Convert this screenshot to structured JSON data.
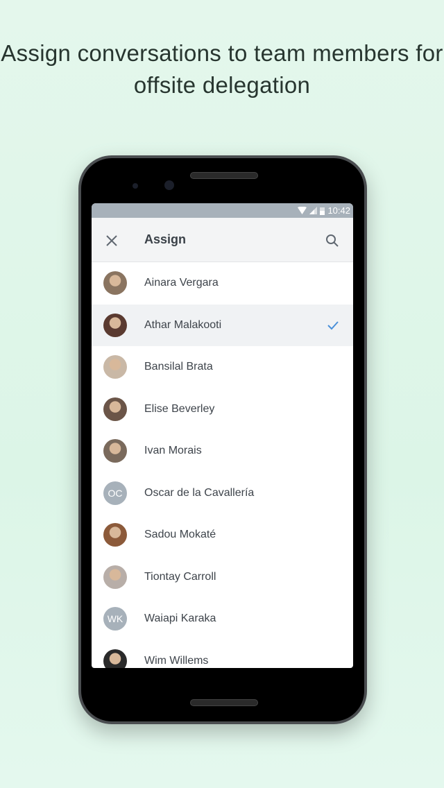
{
  "headline": "Assign conversations to team members for offsite delegation",
  "status_bar": {
    "time": "10:42",
    "icons": [
      "wifi-icon",
      "signal-icon",
      "battery-icon"
    ]
  },
  "app_bar": {
    "title": "Assign",
    "left_icon": "close-icon",
    "right_icon": "search-icon"
  },
  "colors": {
    "accent": "#4a90d9",
    "status_bar": "#a7b1ba",
    "initials_avatar": "#a7b1ba"
  },
  "members": [
    {
      "name": "Ainara Vergara",
      "avatar": "photo",
      "selected": false
    },
    {
      "name": "Athar Malakooti",
      "avatar": "photo",
      "selected": true
    },
    {
      "name": "Bansilal Brata",
      "avatar": "photo",
      "selected": false
    },
    {
      "name": "Elise Beverley",
      "avatar": "photo",
      "selected": false
    },
    {
      "name": "Ivan Morais",
      "avatar": "photo",
      "selected": false
    },
    {
      "name": "Oscar de la Cavallería",
      "avatar": "initials",
      "initials": "OC",
      "selected": false
    },
    {
      "name": "Sadou Mokaté",
      "avatar": "photo",
      "selected": false
    },
    {
      "name": "Tiontay Carroll",
      "avatar": "photo",
      "selected": false
    },
    {
      "name": "Waiapi Karaka",
      "avatar": "initials",
      "initials": "WK",
      "selected": false
    },
    {
      "name": "Wim Willems",
      "avatar": "photo",
      "selected": false
    }
  ]
}
